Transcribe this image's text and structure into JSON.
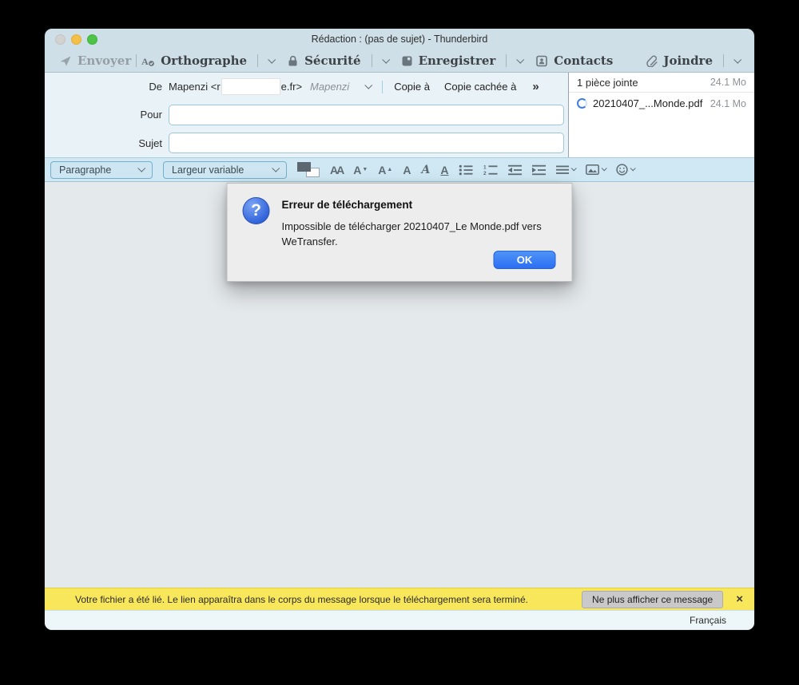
{
  "window": {
    "title": "Rédaction : (pas de sujet) - Thunderbird"
  },
  "toolbar": {
    "send_label": "Envoyer",
    "spelling_label": "Orthographe",
    "security_label": "Sécurité",
    "save_label": "Enregistrer",
    "contacts_label": "Contacts",
    "attach_label": "Joindre"
  },
  "compose": {
    "from_label": "De",
    "from_prefix": "Mapenzi <r",
    "from_suffix": "e.fr>",
    "from_identity": "Mapenzi",
    "cc_button": "Copie à",
    "bcc_button": "Copie cachée à",
    "more_button": "»",
    "to_label": "Pour",
    "to_value": "",
    "subject_label": "Sujet",
    "subject_value": ""
  },
  "attachments": {
    "summary": "1 pièce jointe",
    "total_size": "24.1 Mo",
    "items": [
      {
        "name": "20210407_...Monde.pdf",
        "size": "24.1 Mo"
      }
    ]
  },
  "format_toolbar": {
    "paragraph_select": "Paragraphe",
    "width_select": "Largeur variable"
  },
  "dialog": {
    "title": "Erreur de téléchargement",
    "message": "Impossible de télécharger 20210407_Le Monde.pdf vers WeTransfer.",
    "ok_label": "OK"
  },
  "notification": {
    "message": "Votre fichier a été lié. Le lien apparaîtra dans le corps du message lorsque le téléchargement sera terminé.",
    "dismiss_label": "Ne plus afficher ce message",
    "close_symbol": "×"
  },
  "statusbar": {
    "language": "Français"
  },
  "colors": {
    "accent_blue": "#3f7df5",
    "notification_yellow": "#f8e65b",
    "attachment_progress_blue": "#3f7edd",
    "window_chrome": "#cfdfe8"
  }
}
